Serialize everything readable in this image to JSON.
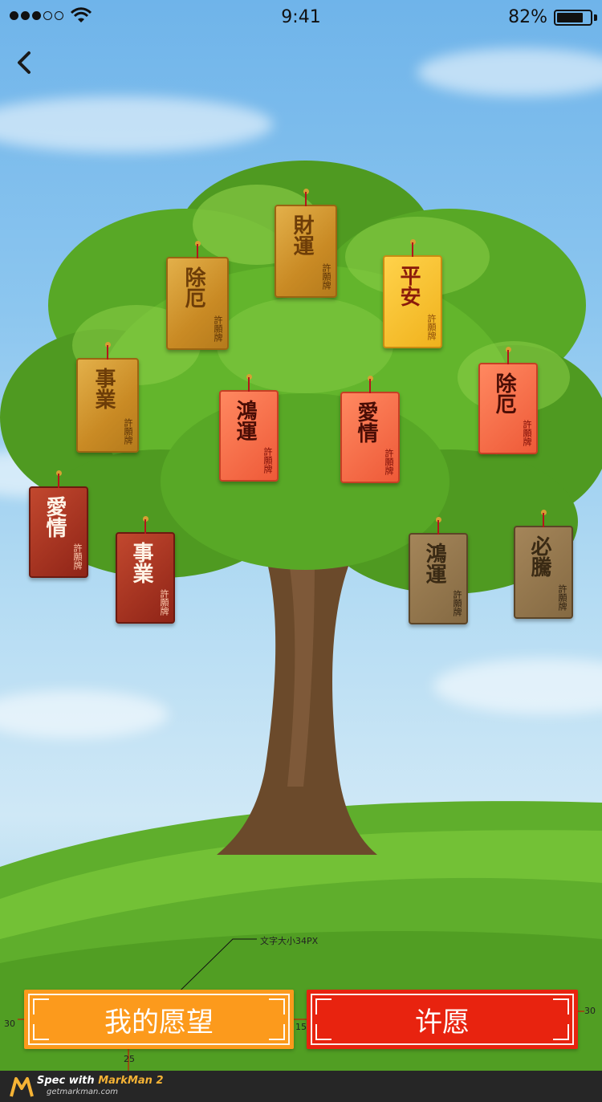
{
  "status_bar": {
    "signal": [
      "full",
      "full",
      "full",
      "empty",
      "empty"
    ],
    "time": "9:41",
    "battery_percent": "82%",
    "battery_level": 0.82
  },
  "nav": {
    "back_icon": "chevron-left-icon"
  },
  "tags": [
    {
      "id": "caiyun",
      "main": "財運",
      "small": "許願牌",
      "style": "gold"
    },
    {
      "id": "chue-top",
      "main": "除厄",
      "small": "許願牌",
      "style": "gold"
    },
    {
      "id": "pingan",
      "main": "平安",
      "small": "許願牌",
      "style": "yellow"
    },
    {
      "id": "shiye-left",
      "main": "事業",
      "small": "許願牌",
      "style": "gold"
    },
    {
      "id": "hongyun-mid",
      "main": "鴻運",
      "small": "許願牌",
      "style": "coral"
    },
    {
      "id": "aiqing-mid",
      "main": "愛情",
      "small": "許願牌",
      "style": "coral"
    },
    {
      "id": "chue-right",
      "main": "除厄",
      "small": "許願牌",
      "style": "coral"
    },
    {
      "id": "aiqing-left",
      "main": "愛情",
      "small": "許願牌",
      "style": "crimson"
    },
    {
      "id": "shiye-bottom",
      "main": "事業",
      "small": "許願牌",
      "style": "crimson"
    },
    {
      "id": "hongyun-right",
      "main": "鴻運",
      "small": "許願牌",
      "style": "tan"
    },
    {
      "id": "biteng",
      "main": "必騰",
      "small": "許願牌",
      "style": "tan"
    }
  ],
  "buttons": {
    "my_wishes": "我的愿望",
    "make_wish": "许愿"
  },
  "spec_annotations": {
    "font_note": "文字大小34PX",
    "left_margin": "30",
    "right_margin": "30",
    "gap": "15",
    "bottom_margin": "25"
  },
  "footer": {
    "title_prefix": "Spec with ",
    "title_brand": "MarkMan 2",
    "url": "getmarkman.com"
  },
  "colors": {
    "orange_button": "#fc9a1c",
    "red_button": "#e8230f",
    "sky_top": "#6fb4ea",
    "grass": "#5fae2c"
  }
}
